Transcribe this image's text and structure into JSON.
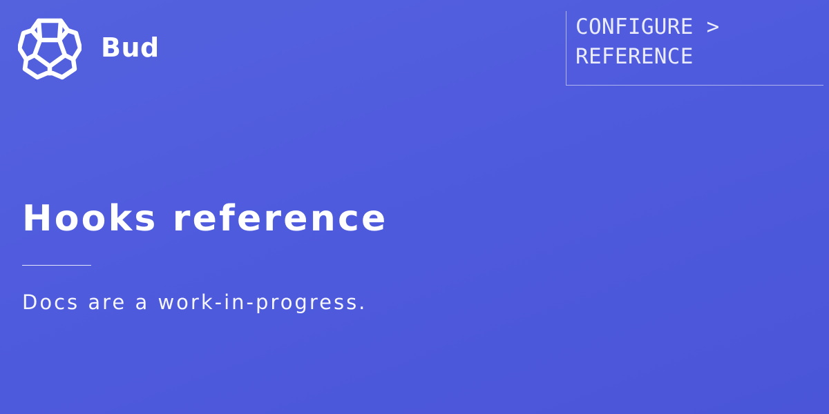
{
  "brand": {
    "name": "Bud",
    "logo_icon": "honeycomb-logo-icon"
  },
  "breadcrumb": {
    "line1": "CONFIGURE >",
    "line2": "REFERENCE"
  },
  "page": {
    "title": "Hooks reference",
    "subtitle": "Docs are a work-in-progress."
  },
  "colors": {
    "background": "#4f5bdd",
    "text": "#ffffff"
  }
}
